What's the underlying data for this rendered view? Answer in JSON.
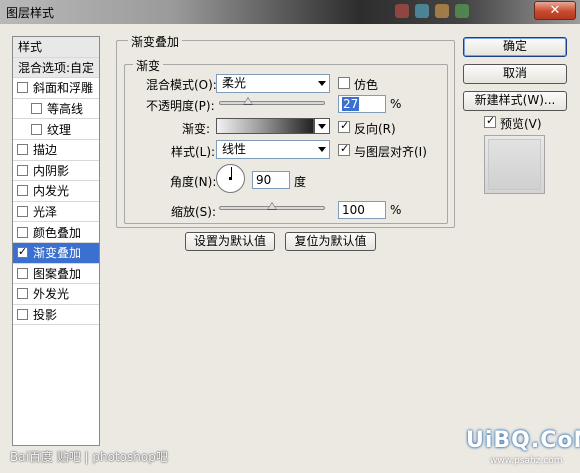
{
  "window": {
    "title": "图层样式",
    "close_glyph": "✕"
  },
  "style_list": {
    "header": "样式",
    "blend_options": "混合选项:自定",
    "items": [
      {
        "label": "斜面和浮雕",
        "checked": false,
        "indent": false
      },
      {
        "label": "等高线",
        "checked": false,
        "indent": true
      },
      {
        "label": "纹理",
        "checked": false,
        "indent": true
      },
      {
        "label": "描边",
        "checked": false,
        "indent": false
      },
      {
        "label": "内阴影",
        "checked": false,
        "indent": false
      },
      {
        "label": "内发光",
        "checked": false,
        "indent": false
      },
      {
        "label": "光泽",
        "checked": false,
        "indent": false
      },
      {
        "label": "颜色叠加",
        "checked": false,
        "indent": false
      },
      {
        "label": "渐变叠加",
        "checked": true,
        "indent": false,
        "selected": true
      },
      {
        "label": "图案叠加",
        "checked": false,
        "indent": false
      },
      {
        "label": "外发光",
        "checked": false,
        "indent": false
      },
      {
        "label": "投影",
        "checked": false,
        "indent": false
      }
    ]
  },
  "panel": {
    "group_title": "渐变叠加",
    "subgroup_title": "渐变",
    "blend_mode_label": "混合模式(O):",
    "blend_mode_value": "柔光",
    "dither_label": "仿色",
    "opacity_label": "不透明度(P):",
    "opacity_value": "27",
    "opacity_fraction": 0.27,
    "percent": "%",
    "gradient_label": "渐变:",
    "reverse_label": "反向(R)",
    "style_label": "样式(L):",
    "style_value": "线性",
    "align_label": "与图层对齐(I)",
    "angle_label": "角度(N):",
    "angle_value": "90",
    "degree_unit": "度",
    "scale_label": "缩放(S):",
    "scale_value": "100",
    "scale_fraction": 0.5,
    "set_default_label": "设置为默认值",
    "reset_default_label": "复位为默认值"
  },
  "buttons": {
    "ok": "确定",
    "cancel": "取消",
    "new_style": "新建样式(W)...",
    "preview_label": "预览(V)"
  },
  "watermarks": {
    "left": "Bai百度 贴吧 | photoshop吧",
    "right": "UiBQ.CoM",
    "right_sub": "www.psahz.com"
  },
  "colors": {
    "accent": "#3b6fd0",
    "close": "#c84a2d"
  }
}
